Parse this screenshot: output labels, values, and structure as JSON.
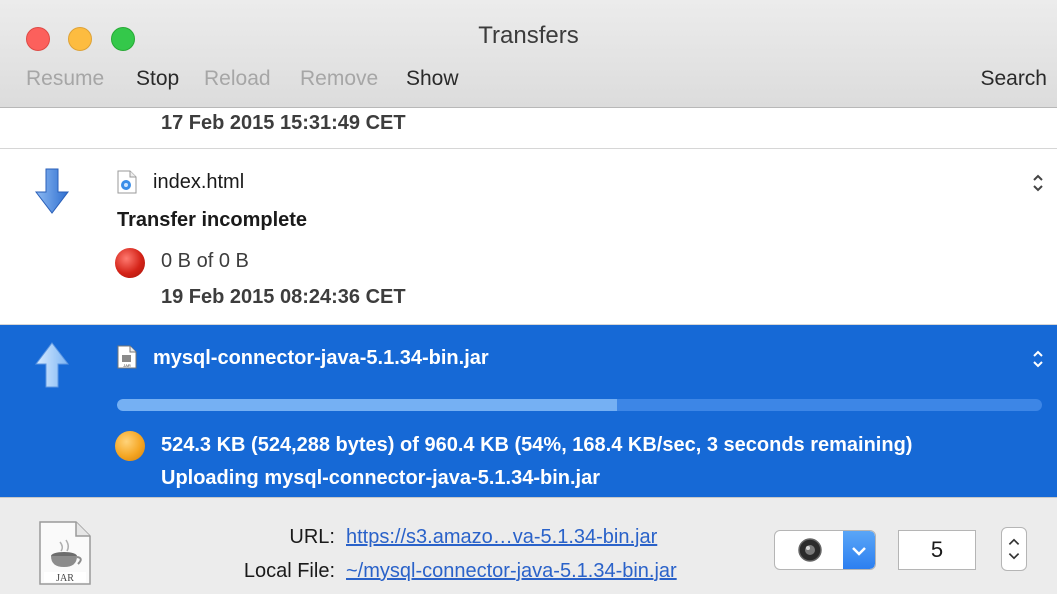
{
  "window": {
    "title": "Transfers"
  },
  "toolbar": {
    "resume": "Resume",
    "stop": "Stop",
    "reload": "Reload",
    "remove": "Remove",
    "show": "Show",
    "search": "Search"
  },
  "transfers": [
    {
      "date": "17 Feb 2015 15:31:49 CET"
    },
    {
      "direction": "download",
      "filename": "index.html",
      "status": "Transfer incomplete",
      "progress_text": "0 B of 0 B",
      "date": "19 Feb 2015 08:24:36 CET",
      "state_color": "#d42318"
    },
    {
      "direction": "upload",
      "filename": "mysql-connector-java-5.1.34-bin.jar",
      "progress": 0.54,
      "progress_text": "524.3 KB (524,288 bytes) of 960.4 KB (54%, 168.4 KB/sec, 3 seconds remaining)",
      "status": "Uploading mysql-connector-java-5.1.34-bin.jar",
      "state_color": "#f5a623",
      "selected": true
    }
  ],
  "details": {
    "url_label": "URL:",
    "url_value": "https://s3.amazo…va-5.1.34-bin.jar",
    "local_label": "Local File:",
    "local_value": "~/mysql-connector-java-5.1.34-bin.jar",
    "file_type_icon": "jar-file-icon",
    "connections": "5"
  },
  "colors": {
    "selection": "#1669d6",
    "link": "#2a62c9"
  }
}
